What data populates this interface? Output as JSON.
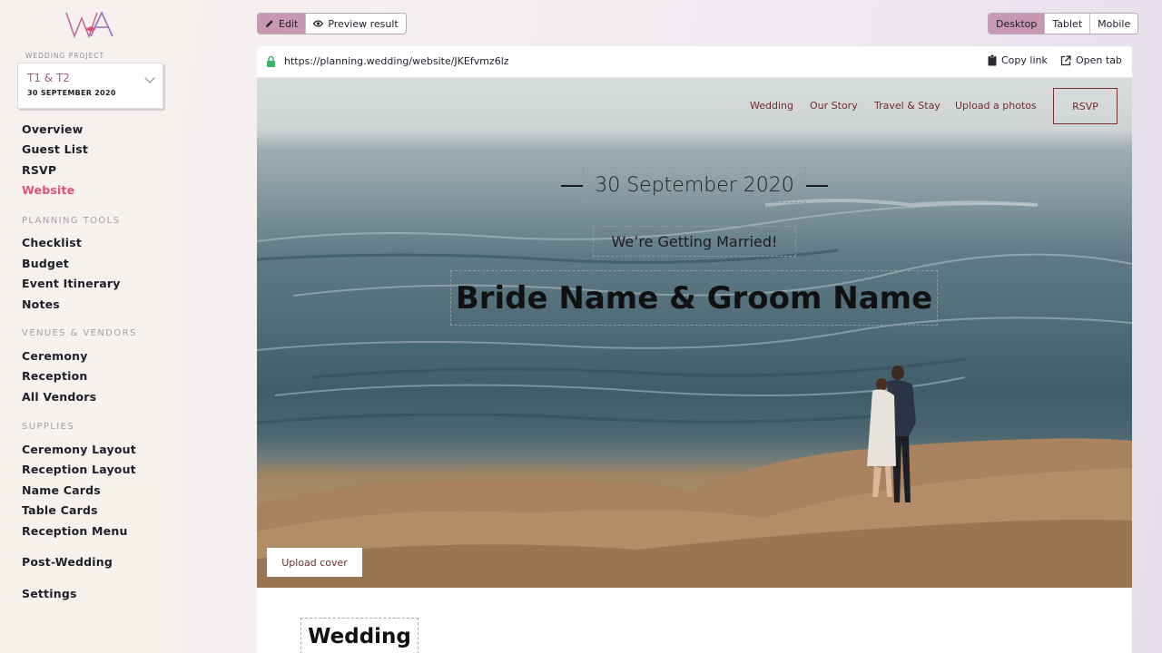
{
  "brand": {
    "logo": "WA",
    "accent": "#c797b4",
    "active": "#e0507c"
  },
  "project": {
    "label": "WEDDING PROJECT",
    "name": "T1 & T2",
    "date": "30 SEPTEMBER 2020"
  },
  "nav": {
    "main": [
      "Overview",
      "Guest List",
      "RSVP",
      "Website"
    ],
    "planning_title": "PLANNING TOOLS",
    "planning": [
      "Checklist",
      "Budget",
      "Event Itinerary",
      "Notes"
    ],
    "venues_title": "VENUES & VENDORS",
    "venues": [
      "Ceremony",
      "Reception",
      "All Vendors"
    ],
    "supplies_title": "SUPPLIES",
    "supplies": [
      "Ceremony Layout",
      "Reception Layout",
      "Name Cards",
      "Table Cards",
      "Reception Menu"
    ],
    "post": "Post-Wedding",
    "settings": "Settings"
  },
  "toolbar": {
    "edit": "Edit",
    "preview": "Preview result"
  },
  "devices": [
    "Desktop",
    "Tablet",
    "Mobile"
  ],
  "browser": {
    "url": "https://planning.wedding/website/JKEfvmz6lz",
    "copy": "Copy link",
    "open": "Open tab"
  },
  "site": {
    "nav": [
      "Wedding",
      "Our Story",
      "Travel & Stay",
      "Upload a photos"
    ],
    "rsvp": "RSVP",
    "date": "30 September 2020",
    "tagline": "We’re Getting Married!",
    "names": "Bride Name & Groom Name",
    "upload_cover": "Upload cover",
    "section_title": "Wedding"
  }
}
